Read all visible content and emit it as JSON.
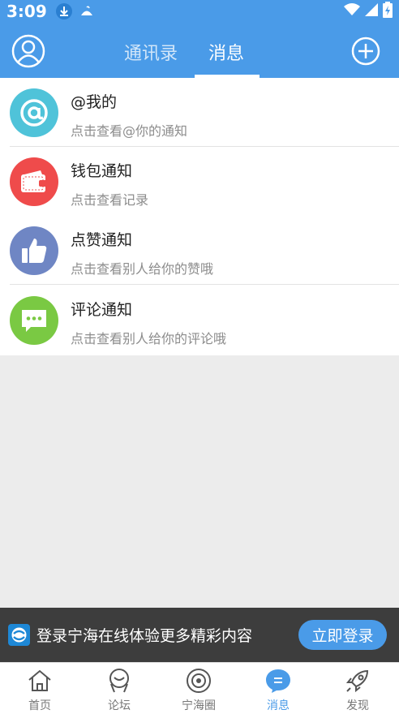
{
  "status_bar": {
    "time": "3:09"
  },
  "header": {
    "tabs": [
      {
        "label": "通讯录",
        "active": false
      },
      {
        "label": "消息",
        "active": true
      }
    ]
  },
  "messages": [
    {
      "icon": "at-icon",
      "color": "#4fc3d9",
      "title": "@我的",
      "subtitle": "点击查看@你的通知"
    },
    {
      "icon": "wallet-icon",
      "color": "#ef4b4b",
      "title": "钱包通知",
      "subtitle": "点击查看记录"
    },
    {
      "icon": "thumbs-up-icon",
      "color": "#6f86c4",
      "title": "点赞通知",
      "subtitle": "点击查看别人给你的赞哦"
    },
    {
      "icon": "comment-icon",
      "color": "#7ac943",
      "title": "评论通知",
      "subtitle": "点击查看别人给你的评论哦"
    }
  ],
  "login_banner": {
    "text": "登录宁海在线体验更多精彩内容",
    "button_label": "立即登录"
  },
  "bottom_nav": [
    {
      "label": "首页",
      "icon": "home-icon",
      "active": false
    },
    {
      "label": "论坛",
      "icon": "forum-icon",
      "active": false
    },
    {
      "label": "宁海圈",
      "icon": "circle-icon",
      "active": false
    },
    {
      "label": "消息",
      "icon": "message-icon",
      "active": true
    },
    {
      "label": "发现",
      "icon": "rocket-icon",
      "active": false
    }
  ],
  "colors": {
    "accent": "#4a9be8",
    "banner_bg": "#3d3d3d",
    "page_bg": "#ececec"
  }
}
